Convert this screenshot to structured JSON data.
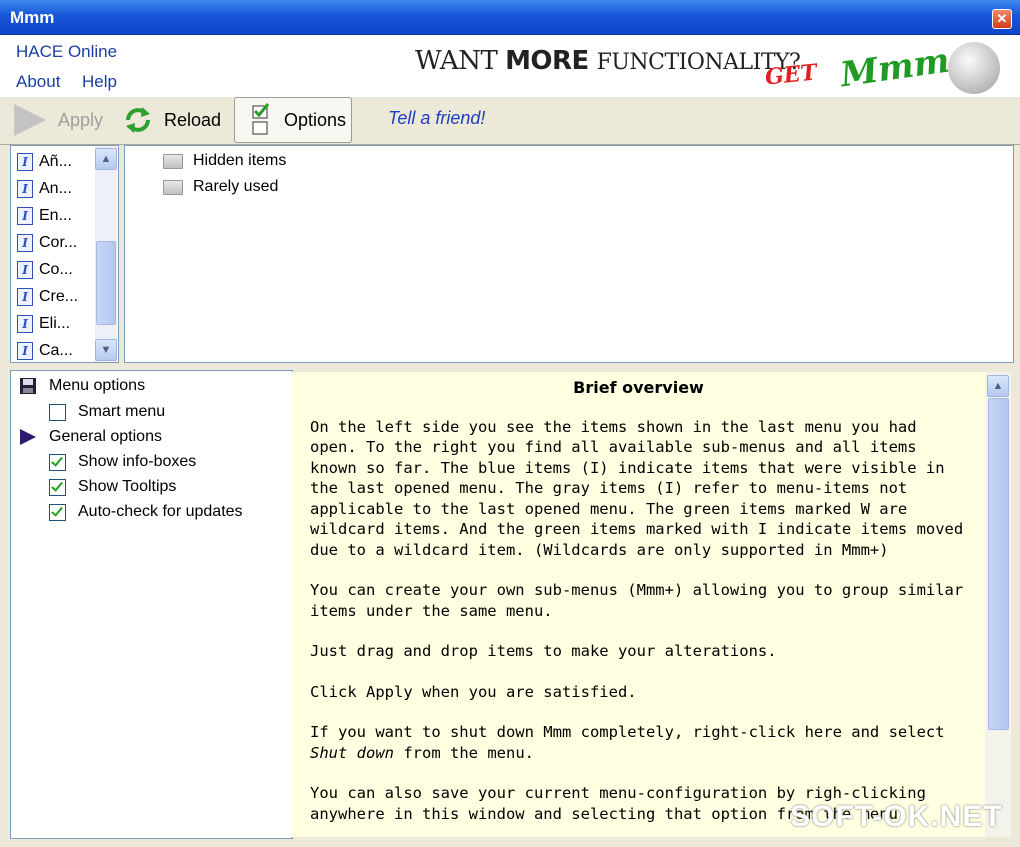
{
  "window": {
    "title": "Mmm"
  },
  "header": {
    "links": {
      "hace_online": "HACE Online",
      "about": "About",
      "help": "Help"
    },
    "banner": {
      "want": "WANT ",
      "more": "MORE",
      "functionality": "FUNCTIONALITY?",
      "get": "GET",
      "mmm_plus": "Mmm+"
    }
  },
  "toolbar": {
    "apply": "Apply",
    "reload": "Reload",
    "options": "Options",
    "tell_friend": "Tell a friend!"
  },
  "menu_items": [
    "Añ...",
    "An...",
    "En...",
    "Cor...",
    "Co...",
    "Cre...",
    "Eli...",
    "Ca..."
  ],
  "folders": [
    "Hidden items",
    "Rarely used"
  ],
  "options": {
    "menu_options": "Menu options",
    "smart_menu": "Smart menu",
    "general_options": "General options",
    "show_info_boxes": "Show info-boxes",
    "show_tooltips": "Show Tooltips",
    "auto_check": "Auto-check for updates",
    "state": {
      "smart_menu": false,
      "show_info_boxes": true,
      "show_tooltips": true,
      "auto_check": true
    }
  },
  "overview": {
    "title": "Brief overview",
    "p1": "On the left side you see the items shown in the last menu you had open. To the right you find all available sub-menus and all items known so far. The blue items (I) indicate items that were visible in the last opened menu. The gray items (I) refer to menu-items not applicable to the last opened menu. The green items marked W are wildcard items. And the green items marked with I indicate items moved due to a wildcard item. (Wildcards are only supported in Mmm+)",
    "p2": "You can create your own sub-menus (Mmm+) allowing you to group similar items under the same menu.",
    "p3": "Just  drag and drop items to make your alterations.",
    "p4": "Click Apply when you are satisfied.",
    "p5a": "If you want to shut down Mmm completely, right-click here and select ",
    "p5b": "Shut down",
    "p5c": " from the menu.",
    "p6": "You can also save your current menu-configuration by righ-clicking anywhere in this window and selecting that option from the menu."
  },
  "watermark": "SOFT-OK.NET"
}
